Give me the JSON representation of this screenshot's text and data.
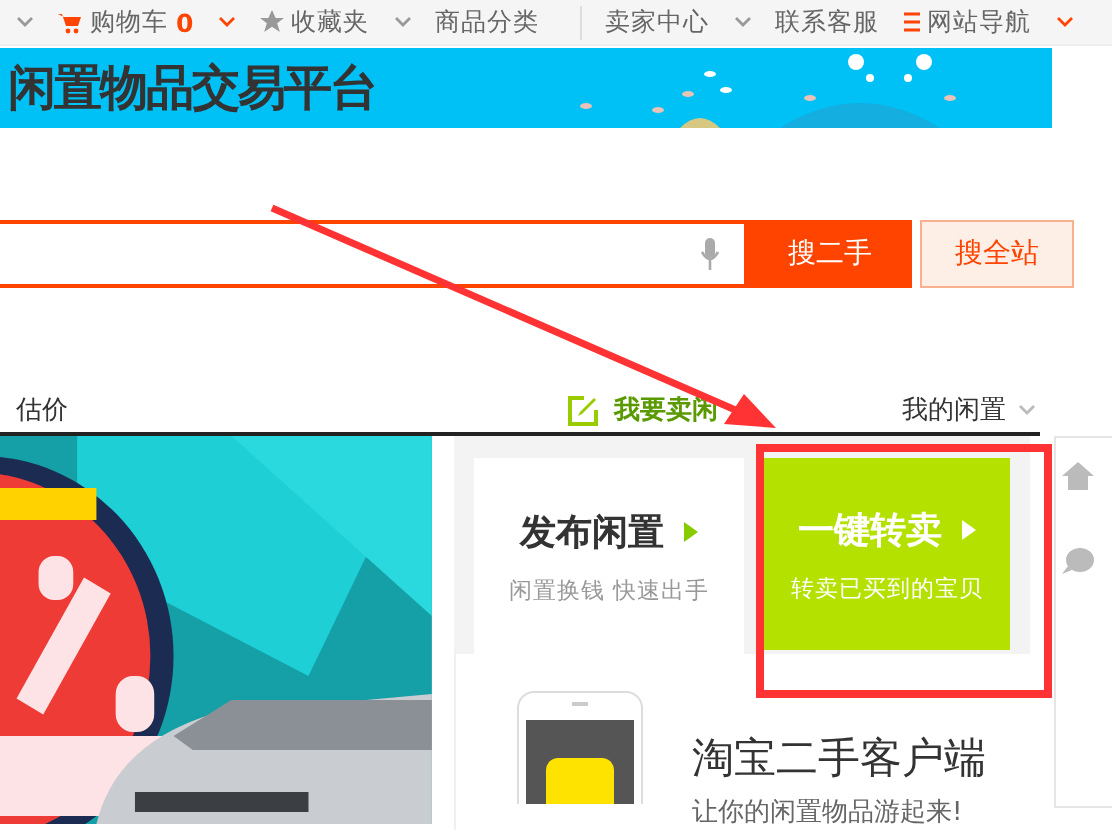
{
  "top_nav": {
    "items": [
      {
        "kind": "cart",
        "label": "购物车",
        "count": "0",
        "has_menu": true,
        "separated": false
      },
      {
        "kind": "star",
        "label": "收藏夹",
        "has_menu": true,
        "separated": false
      },
      {
        "kind": "plain",
        "label": "商品分类",
        "has_menu": false,
        "separated": false
      },
      {
        "kind": "plain",
        "label": "卖家中心",
        "has_menu": true,
        "separated": true
      },
      {
        "kind": "plain",
        "label": "联系客服",
        "has_menu": false,
        "separated": false
      },
      {
        "kind": "list",
        "label": "网站导航",
        "has_menu": true,
        "separated": false
      }
    ]
  },
  "banner": {
    "title": "闲置物品交易平台"
  },
  "search": {
    "buttons": [
      {
        "label": "搜二手",
        "selected": true
      },
      {
        "label": "搜全站",
        "selected": false
      }
    ]
  },
  "sub_nav": {
    "left": "估价",
    "sell_link": "我要卖闲",
    "my_menu": "我的闲置"
  },
  "publish": {
    "title": "发布闲置",
    "subtitle": "闲置换钱 快速出手"
  },
  "resell": {
    "title": "一键转卖",
    "subtitle": "转卖已买到的宝贝"
  },
  "app": {
    "title": "淘宝二手客户端",
    "subtitle": "让你的闲置物品游起来!"
  }
}
